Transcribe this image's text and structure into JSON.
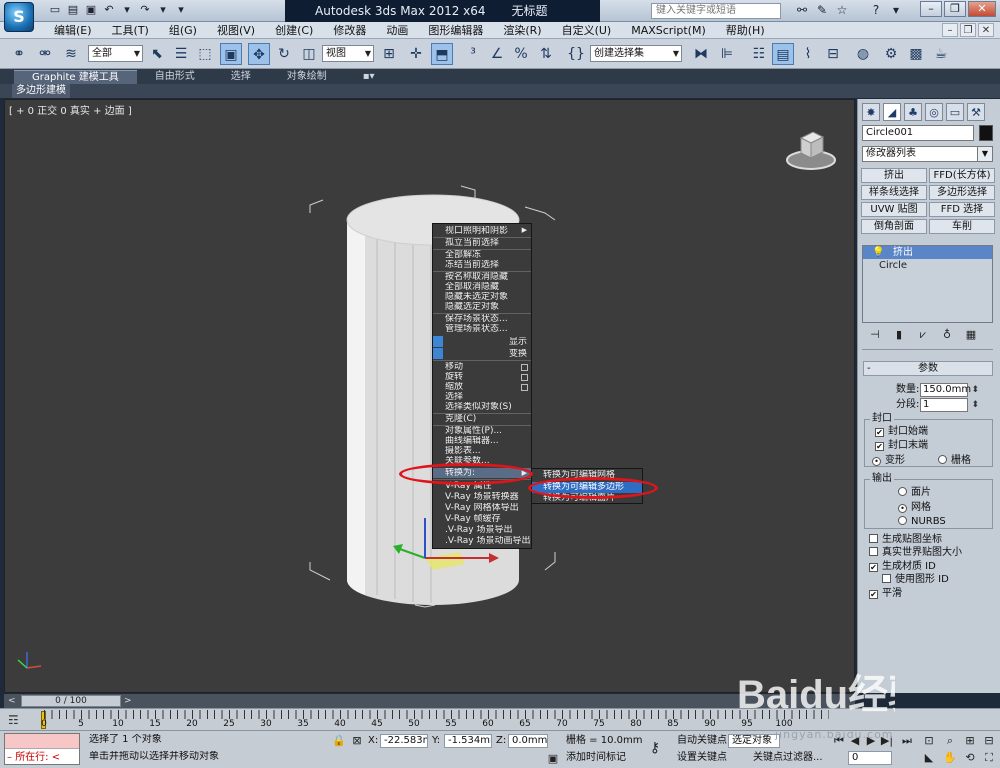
{
  "titlebar": {
    "app_name": "Autodesk 3ds Max  2012 x64",
    "doc_name": "无标题",
    "search_placeholder": "键入关键字或短语"
  },
  "menubar": {
    "items": [
      "编辑(E)",
      "工具(T)",
      "组(G)",
      "视图(V)",
      "创建(C)",
      "修改器",
      "动画",
      "图形编辑器",
      "渲染(R)",
      "自定义(U)",
      "MAXScript(M)",
      "帮助(H)"
    ]
  },
  "toolbar": {
    "filter": "全部",
    "ref_coord": "视图",
    "named_selection": "创建选择集"
  },
  "ribbon": {
    "tabs": [
      "Graphite 建模工具",
      "自由形式",
      "选择",
      "对象绘制"
    ],
    "subtab": "多边形建模"
  },
  "viewport": {
    "label": "[ + 0 正交 0 真实 + 边面 ]"
  },
  "context_menu": {
    "quad_top_items": [
      "视口照明和阴影",
      "孤立当前选择",
      "全部解冻",
      "冻结当前选择",
      "按名称取消隐藏",
      "全部取消隐藏",
      "隐藏未选定对象",
      "隐藏选定对象",
      "保存场景状态...",
      "管理场景状态..."
    ],
    "header_display": "显示",
    "header_transform": "变换",
    "quad_bottom_items": [
      "移动",
      "旋转",
      "缩放",
      "选择",
      "选择类似对象(S)",
      "克隆(C)",
      "对象属性(P)...",
      "曲线编辑器...",
      "摄影表...",
      "关联参数...",
      "转换为:",
      "V-Ray 属性",
      "V-Ray 场景转换器",
      "V-Ray 网格体导出",
      "V-Ray 帧缓存",
      ".V-Ray 场景导出",
      ".V-Ray 场景动画导出"
    ],
    "highlighted_item": "转换为:"
  },
  "submenu": {
    "items": [
      "转换为可编辑网格",
      "转换为可编辑多边形",
      "转换为可编辑面片"
    ],
    "highlighted": "转换为可编辑多边形"
  },
  "command_panel": {
    "object_name": "Circle001",
    "modifier_list": "修改器列表",
    "modifier_buttons": [
      "挤出",
      "FFD(长方体)",
      "样条线选择",
      "多边形选择",
      "UVW 贴图",
      "FFD 选择",
      "倒角剖面",
      "车削"
    ],
    "stack": [
      "挤出",
      "Circle"
    ],
    "params_title": "参数",
    "amount_label": "数量:",
    "amount_value": "150.0mm",
    "segments_label": "分段:",
    "segments_value": "1",
    "capping_title": "封口",
    "cap_start": "封口始端",
    "cap_end": "封口末端",
    "morph": "变形",
    "grid": "栅格",
    "output_title": "输出",
    "out_patch": "面片",
    "out_mesh": "网格",
    "out_nurbs": "NURBS",
    "gen_mapping": "生成贴图坐标",
    "real_world": "真实世界贴图大小",
    "gen_mat_id": "生成材质 ID",
    "use_shape_id": "使用图形 ID",
    "smooth": "平滑"
  },
  "timeline": {
    "frame_display": "0 / 100",
    "ticks": [
      "0",
      "5",
      "10",
      "15",
      "20",
      "25",
      "30",
      "35",
      "40",
      "45",
      "50",
      "55",
      "60",
      "65",
      "70",
      "75",
      "80",
      "85",
      "90",
      "95",
      "100"
    ]
  },
  "status": {
    "maxscript_line": "所在行:",
    "selection_text": "选择了 1 个对象",
    "prompt_text": "单击并拖动以选择并移动对象",
    "x_label": "X:",
    "x_value": "-22.583mm",
    "y_label": "Y:",
    "y_value": "-1.534mm",
    "z_label": "Z:",
    "z_value": "0.0mm",
    "grid_label": "栅格 = 10.0mm",
    "add_time_tag": "添加时间标记",
    "auto_key": "自动关键点",
    "selected_obj": "选定对象",
    "set_key": "设置关键点",
    "key_filters": "关键点过滤器...",
    "frame_value": "0"
  },
  "watermark": {
    "brand": "Baidu经验",
    "site": "jingyan.baidu.com"
  }
}
